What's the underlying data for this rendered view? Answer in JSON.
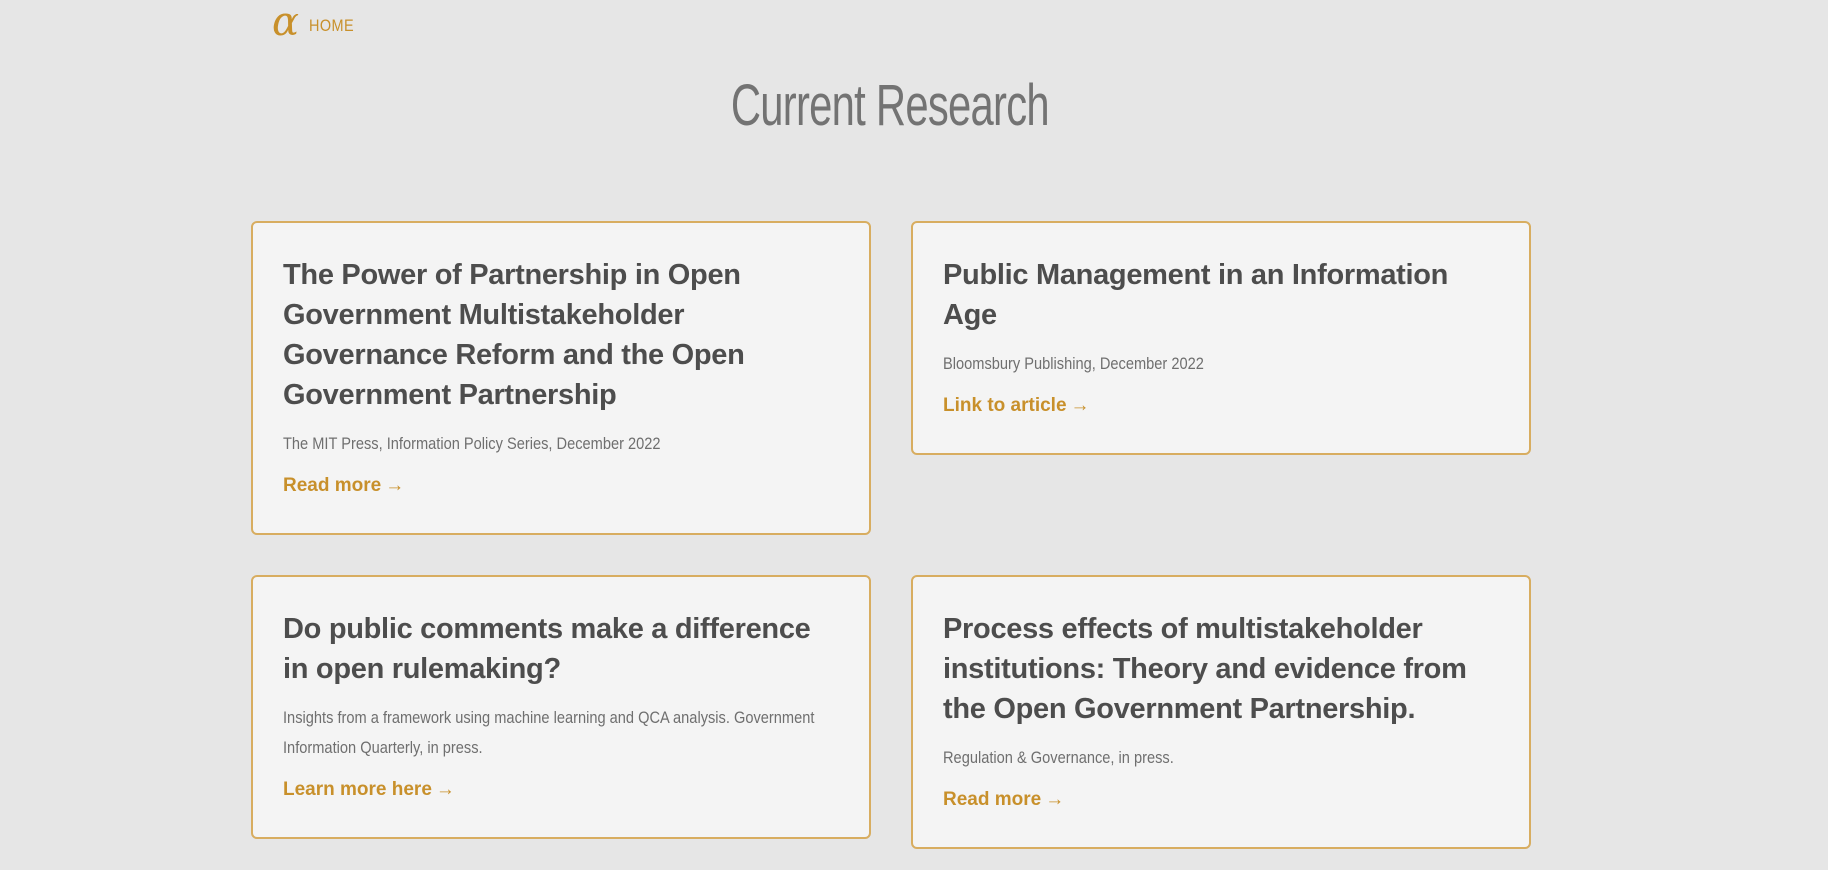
{
  "nav": {
    "logo_glyph": "α",
    "home_label": "HOME"
  },
  "page": {
    "title": "Current Research"
  },
  "cards": [
    {
      "title": "The Power of Partnership in Open Government Multistakeholder Governance Reform and the Open Government Partnership",
      "meta": "The MIT Press, Information Policy Series, December 2022",
      "link_label": "Read more",
      "link_arrow": "→"
    },
    {
      "title": "Public Management in an Information Age",
      "meta": "Bloomsbury Publishing, December 2022",
      "link_label": "Link to article",
      "link_arrow": "→"
    },
    {
      "title": "Do public comments make a difference in open rulemaking?",
      "meta": "Insights from a framework using machine learning and QCA analysis. Government Information Quarterly, in press.",
      "link_label": "Learn more here",
      "link_arrow": "→"
    },
    {
      "title": "Process effects of multistakeholder institutions: Theory and evidence from the Open Government Partnership.",
      "meta": "Regulation & Governance, in press.",
      "link_label": "Read more",
      "link_arrow": "→"
    }
  ],
  "colors": {
    "accent": "#c8902b",
    "card_border": "#d8ad60",
    "background": "#e6e6e6",
    "card_background": "#f4f4f4",
    "title_text": "#4d4d4d"
  }
}
